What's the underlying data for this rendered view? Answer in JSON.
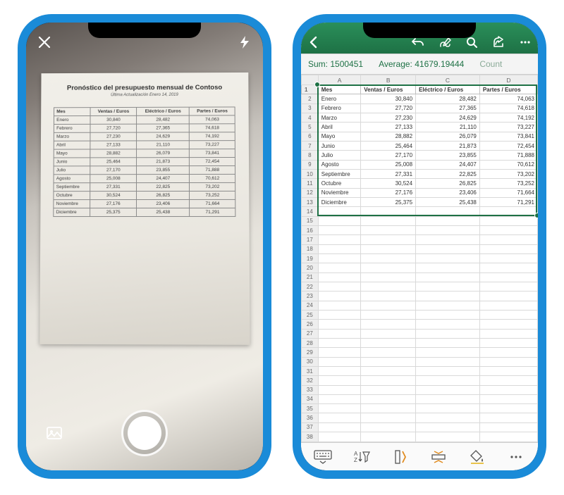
{
  "camera": {
    "doc_title": "Pronóstico del  presupuesto mensual de Contoso",
    "doc_subtitle": "Última Actualización Enero 14, 2019",
    "headers": [
      "Mes",
      "Ventas / Euros",
      "Eléctrico / Euros",
      "Partes / Euros"
    ],
    "rows": [
      [
        "Enero",
        "30,840",
        "28,482",
        "74,063"
      ],
      [
        "Febrero",
        "27,720",
        "27,365",
        "74,618"
      ],
      [
        "Marzo",
        "27,230",
        "24,629",
        "74,192"
      ],
      [
        "Abril",
        "27,133",
        "21,110",
        "73,227"
      ],
      [
        "Mayo",
        "28,882",
        "26,079",
        "73,841"
      ],
      [
        "Junio",
        "25,464",
        "21,873",
        "72,454"
      ],
      [
        "Julio",
        "27,170",
        "23,855",
        "71,888"
      ],
      [
        "Agosto",
        "25,008",
        "24,407",
        "70,612"
      ],
      [
        "Septiembre",
        "27,331",
        "22,825",
        "73,202"
      ],
      [
        "Octubre",
        "30,524",
        "26,825",
        "73,252"
      ],
      [
        "Noviembre",
        "27,176",
        "23,406",
        "71,664"
      ],
      [
        "Diciembre",
        "25,375",
        "25,438",
        "71,291"
      ]
    ]
  },
  "excel": {
    "stats": {
      "sum_label": "Sum:",
      "sum_value": "1500451",
      "avg_label": "Average:",
      "avg_value": "41679.19444",
      "count_label": "Count"
    },
    "col_headers": [
      "",
      "A",
      "B",
      "C",
      "D"
    ],
    "grid_headers": [
      "Mes",
      "Ventas / Euros",
      "Eléctrico / Euros",
      "Partes / Euros"
    ],
    "rows": [
      [
        "Enero",
        "30,840",
        "28,482",
        "74,063"
      ],
      [
        "Febrero",
        "27,720",
        "27,365",
        "74,618"
      ],
      [
        "Marzo",
        "27,230",
        "24,629",
        "74,192"
      ],
      [
        "Abril",
        "27,133",
        "21,110",
        "73,227"
      ],
      [
        "Mayo",
        "28,882",
        "26,079",
        "73,841"
      ],
      [
        "Junio",
        "25,464",
        "21,873",
        "72,454"
      ],
      [
        "Julio",
        "27,170",
        "23,855",
        "71,888"
      ],
      [
        "Agosto",
        "25,008",
        "24,407",
        "70,612"
      ],
      [
        "Septiembre",
        "27,331",
        "22,825",
        "73,202"
      ],
      [
        "Octubre",
        "30,524",
        "26,825",
        "73,252"
      ],
      [
        "Noviembre",
        "27,176",
        "23,406",
        "71,664"
      ],
      [
        "Diciembre",
        "25,375",
        "25,438",
        "71,291"
      ]
    ],
    "empty_rows_from": 14,
    "empty_rows_to": 38
  },
  "chart_data": {
    "type": "table",
    "title": "Pronóstico del presupuesto mensual de Contoso",
    "columns": [
      "Mes",
      "Ventas / Euros",
      "Eléctrico / Euros",
      "Partes / Euros"
    ],
    "rows": [
      [
        "Enero",
        30840,
        28482,
        74063
      ],
      [
        "Febrero",
        27720,
        27365,
        74618
      ],
      [
        "Marzo",
        27230,
        24629,
        74192
      ],
      [
        "Abril",
        27133,
        21110,
        73227
      ],
      [
        "Mayo",
        28882,
        26079,
        73841
      ],
      [
        "Junio",
        25464,
        21873,
        72454
      ],
      [
        "Julio",
        27170,
        23855,
        71888
      ],
      [
        "Agosto",
        25008,
        24407,
        70612
      ],
      [
        "Septiembre",
        27331,
        22825,
        73202
      ],
      [
        "Octubre",
        30524,
        26825,
        73252
      ],
      [
        "Noviembre",
        27176,
        23406,
        71664
      ],
      [
        "Diciembre",
        25375,
        25438,
        71291
      ]
    ]
  }
}
